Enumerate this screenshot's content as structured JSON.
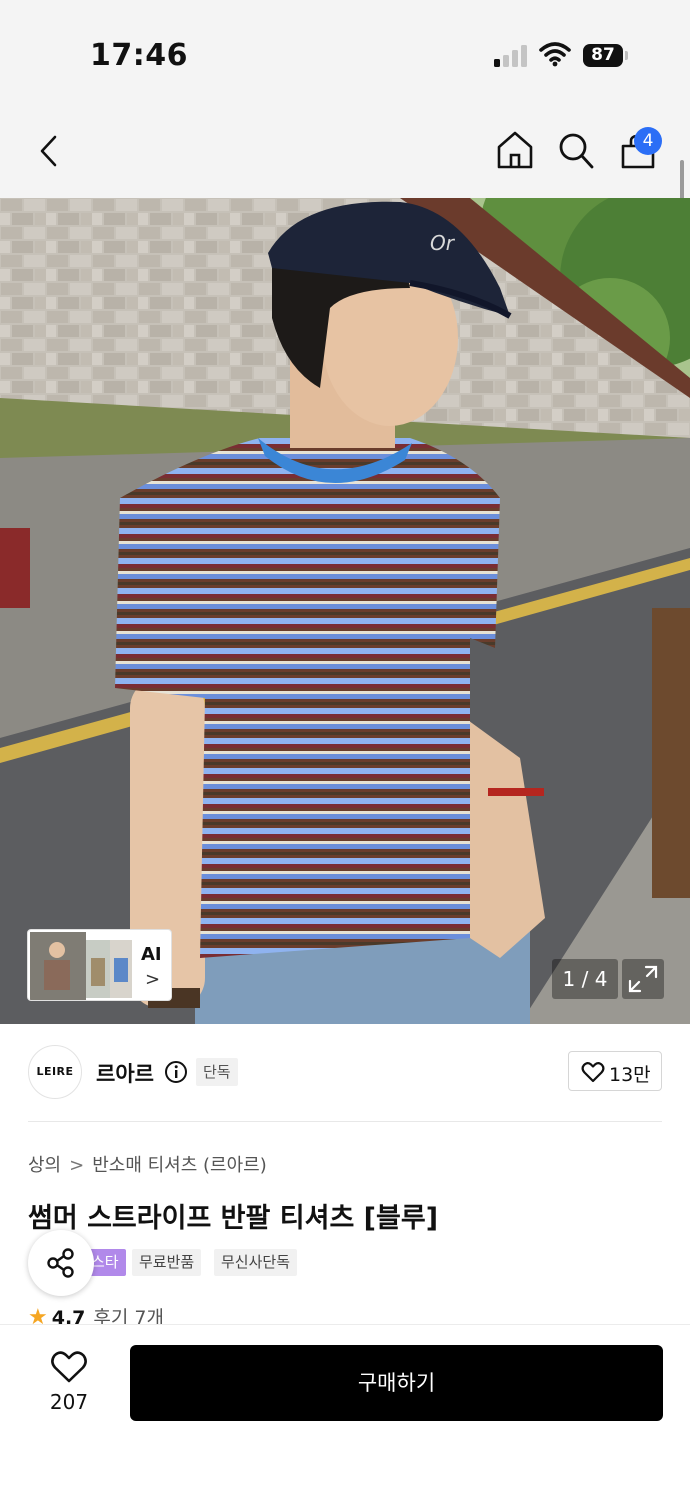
{
  "status_bar": {
    "time": "17:46",
    "battery": "87"
  },
  "nav": {
    "cart_count": "4",
    "back_icon": "chevron-left-icon",
    "home_icon": "home-icon",
    "search_icon": "search-icon",
    "cart_icon": "shopping-bag-icon"
  },
  "gallery": {
    "ai_label": "AI",
    "ai_chevron": ">",
    "counter": "1 / 4"
  },
  "brand": {
    "logo_text": "LEIRE",
    "name": "르아르",
    "exclusive_badge": "단독",
    "likes": "13만"
  },
  "product": {
    "category": "상의",
    "subcategory": "반소매 티셔츠 (르아르)",
    "title": "썸머 스트라이프 반팔 티셔츠 [블루]",
    "tags": [
      "스타",
      "무료반품",
      "무신사단독"
    ],
    "rating": "4.7",
    "reviews": "후기 7개"
  },
  "bottom_bar": {
    "wishlist_count": "207",
    "buy_label": "구매하기"
  },
  "colors": {
    "badge_blue": "#2b6ef6",
    "tag_purple": "#b189ea",
    "star": "#f5a623",
    "buy_button": "#000000"
  }
}
